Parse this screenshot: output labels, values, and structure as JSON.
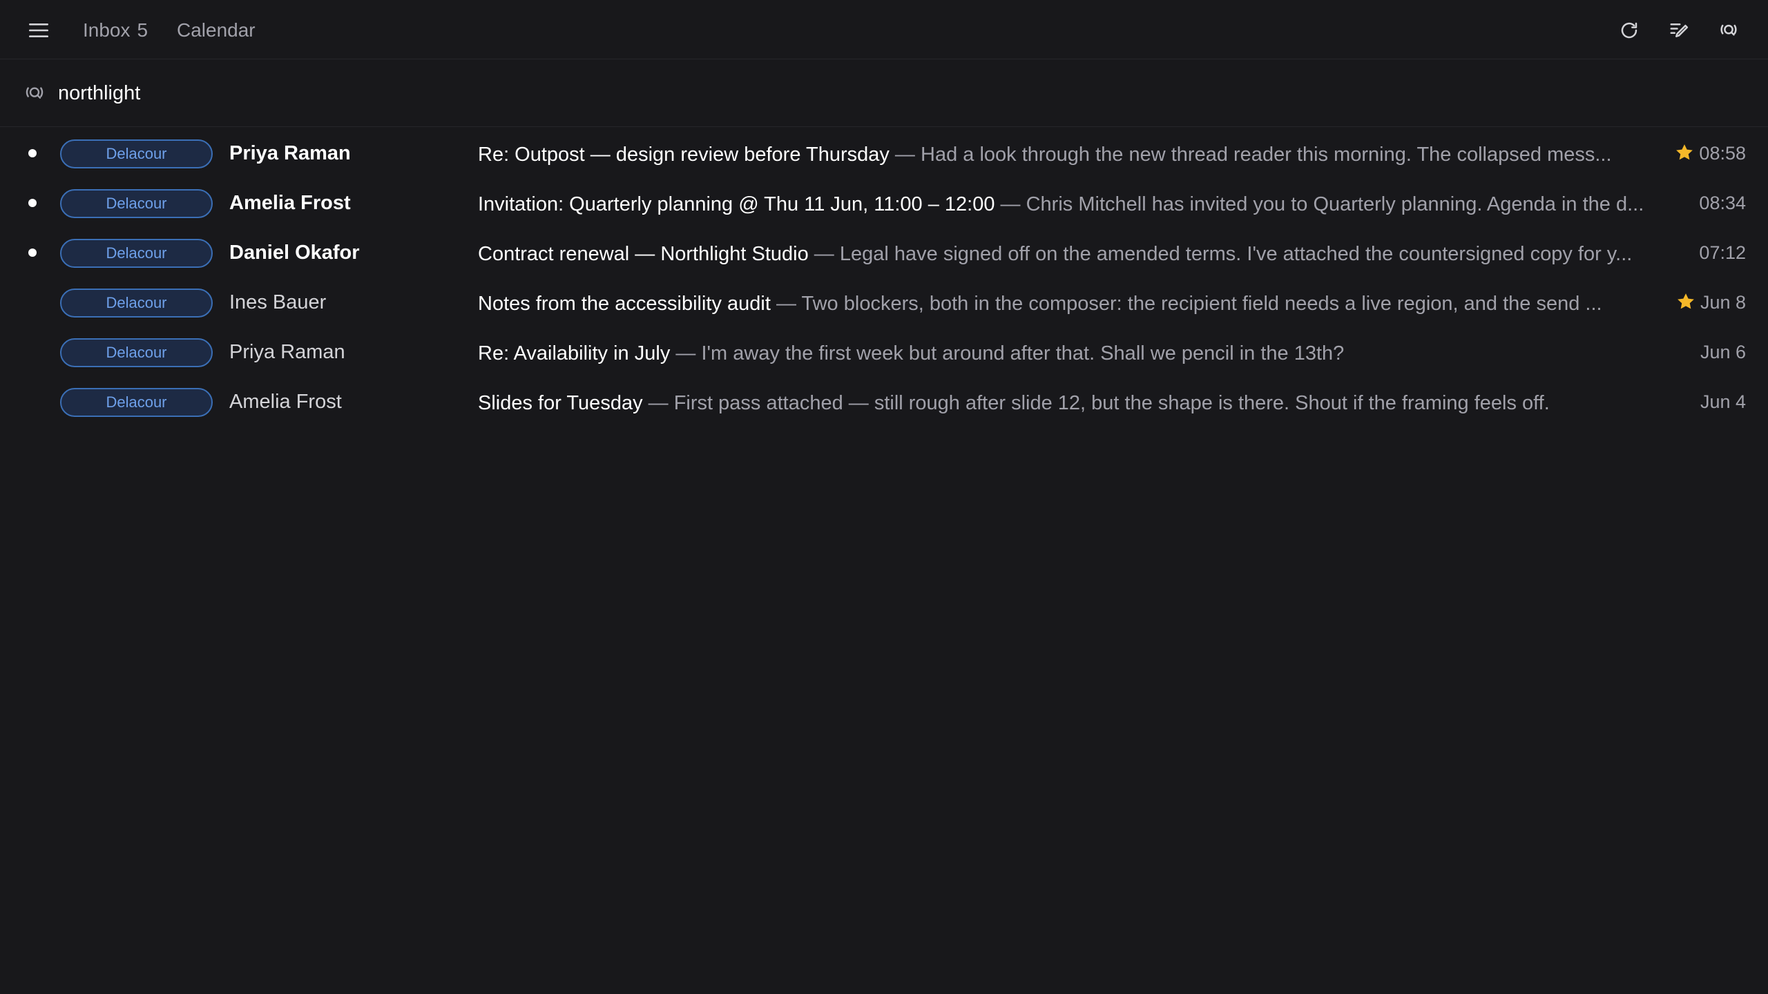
{
  "header": {
    "menu_icon": "menu-icon",
    "tabs": [
      {
        "label": "Inbox",
        "count": "5"
      },
      {
        "label": "Calendar"
      }
    ],
    "actions": [
      "refresh-icon",
      "compose-icon",
      "search-icon"
    ]
  },
  "search": {
    "query": "northlight",
    "icon": "search-icon"
  },
  "colors": {
    "background": "#18181b",
    "tag_border": "#3b6fb6",
    "tag_text": "#6ea0ea",
    "star": "#f5b829",
    "unread_dot": "#ffffff"
  },
  "messages": [
    {
      "unread": true,
      "tag": "Delacour",
      "sender": "Priya Raman",
      "subject": "Re: Outpost — design review before Thursday",
      "separator": " — ",
      "snippet": "Had a look through the new thread reader this morning. The collapsed mess...",
      "starred": true,
      "time": "08:58"
    },
    {
      "unread": true,
      "tag": "Delacour",
      "sender": "Amelia Frost",
      "subject": "Invitation: Quarterly planning @ Thu 11 Jun, 11:00 – 12:00",
      "separator": " — ",
      "snippet": "Chris Mitchell has invited you to Quarterly planning. Agenda in the d...",
      "starred": false,
      "time": "08:34"
    },
    {
      "unread": true,
      "tag": "Delacour",
      "sender": "Daniel Okafor",
      "subject": "Contract renewal — Northlight Studio",
      "separator": " — ",
      "snippet": "Legal have signed off on the amended terms. I've attached the countersigned copy for y...",
      "starred": false,
      "time": "07:12"
    },
    {
      "unread": false,
      "tag": "Delacour",
      "sender": "Ines Bauer",
      "subject": "Notes from the accessibility audit",
      "separator": " — ",
      "snippet": "Two blockers, both in the composer: the recipient field needs a live region, and the send ...",
      "starred": true,
      "time": "Jun 8"
    },
    {
      "unread": false,
      "tag": "Delacour",
      "sender": "Priya Raman",
      "subject": "Re: Availability in July",
      "separator": " — ",
      "snippet": "I'm away the first week but around after that. Shall we pencil in the 13th?",
      "starred": false,
      "time": "Jun 6"
    },
    {
      "unread": false,
      "tag": "Delacour",
      "sender": "Amelia Frost",
      "subject": "Slides for Tuesday",
      "separator": " — ",
      "snippet": "First pass attached — still rough after slide 12, but the shape is there. Shout if the framing feels off.",
      "starred": false,
      "time": "Jun 4"
    }
  ]
}
